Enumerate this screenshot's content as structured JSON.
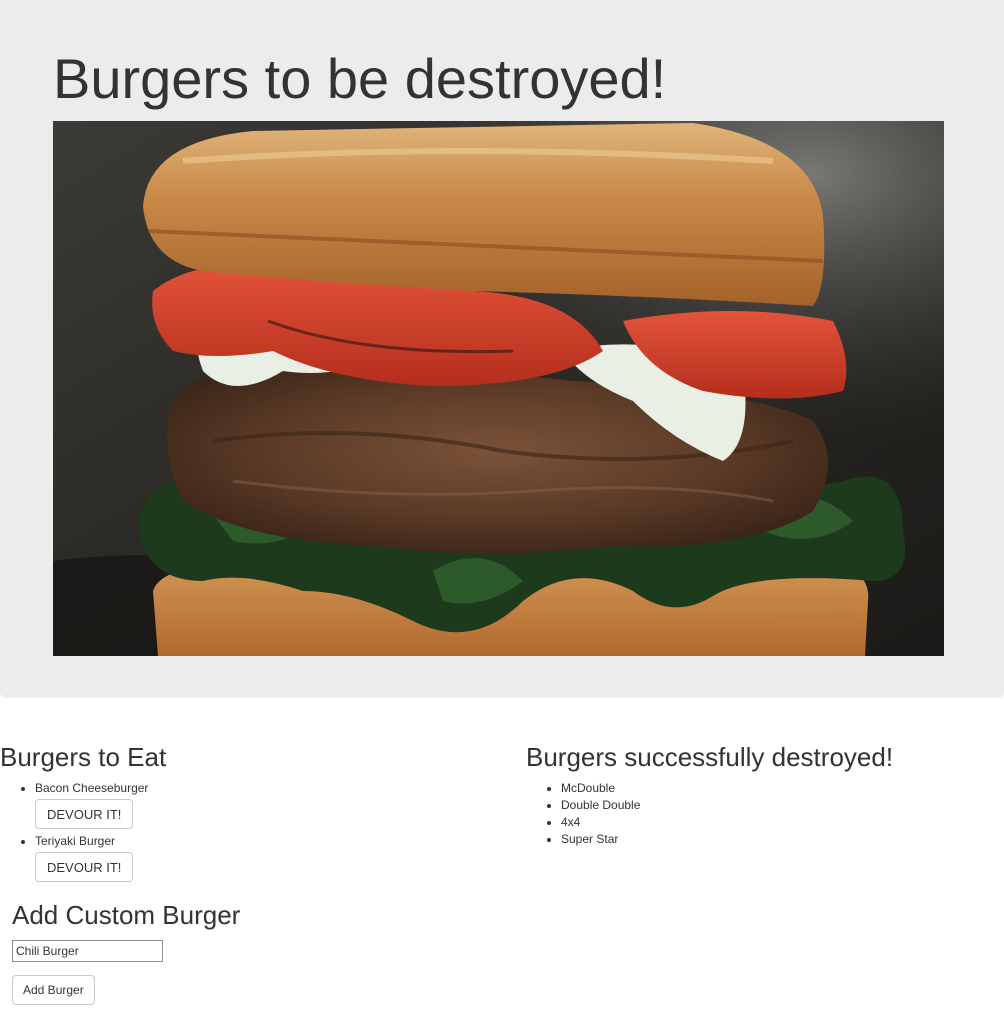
{
  "jumbotron": {
    "title": "Burgers to be destroyed!",
    "image": "burger-photo"
  },
  "to_eat": {
    "title": "Burgers to Eat",
    "items": [
      {
        "name": "Bacon Cheeseburger",
        "button": "DEVOUR IT!"
      },
      {
        "name": "Teriyaki Burger",
        "button": "DEVOUR IT!"
      }
    ]
  },
  "destroyed": {
    "title": "Burgers successfully destroyed!",
    "items": [
      "McDouble",
      "Double Double",
      "4x4",
      "Super Star"
    ]
  },
  "add_form": {
    "title": "Add Custom Burger",
    "input_value": "Chili Burger",
    "button": "Add Burger"
  }
}
